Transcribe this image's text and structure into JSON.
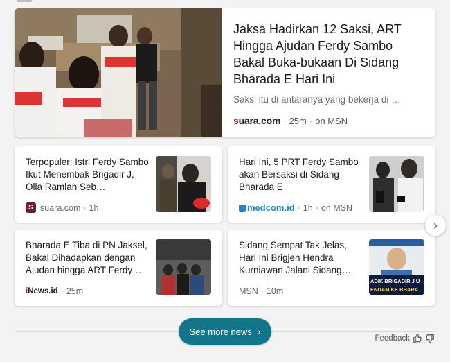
{
  "hero": {
    "title": "Jaksa Hadirkan 12 Saksi, ART Hingga Ajudan Ferdy Sambo Bakal Buka-bukaan Di Sidang Bharada E Hari Ini",
    "snippet": "Saksi itu di antaranya yang bekerja di …",
    "source_logo_prefix": "s",
    "source_logo_rest": "uara.com",
    "time": "25m",
    "via": "on MSN"
  },
  "cards": [
    {
      "title": "Terpopuler: Istri Ferdy Sambo Ikut Menembak Brigadir J, Olla Ramlan Seb…",
      "favicon": "S",
      "source": "suara.com",
      "time": "1h",
      "via": ""
    },
    {
      "title": "Hari Ini, 5 PRT Ferdy Sambo akan Bersaksi di Sidang Bharada E",
      "source": "medcom.id",
      "time": "1h",
      "via": "on MSN"
    },
    {
      "title": "Bharada E Tiba di PN Jaksel, Bakal Dihadapkan dengan Ajudan hingga ART Ferdy…",
      "source_prefix": "i",
      "source_rest": "News.id",
      "time": "25m",
      "via": ""
    },
    {
      "title": "Sidang Sempat Tak Jelas, Hari Ini Brigjen Hendra Kurniawan Jalani Sidang…",
      "source": "MSN",
      "time": "10m",
      "via": "",
      "thumb_caption_1": "ADIK BRIGADIR J U",
      "thumb_caption_2": "ENDAM KE BHARA"
    }
  ],
  "see_more_label": "See more news",
  "feedback_label": "Feedback",
  "colors": {
    "accent": "#13758a",
    "suara_red": "#e0101a",
    "medcom_blue": "#1e88c8"
  }
}
